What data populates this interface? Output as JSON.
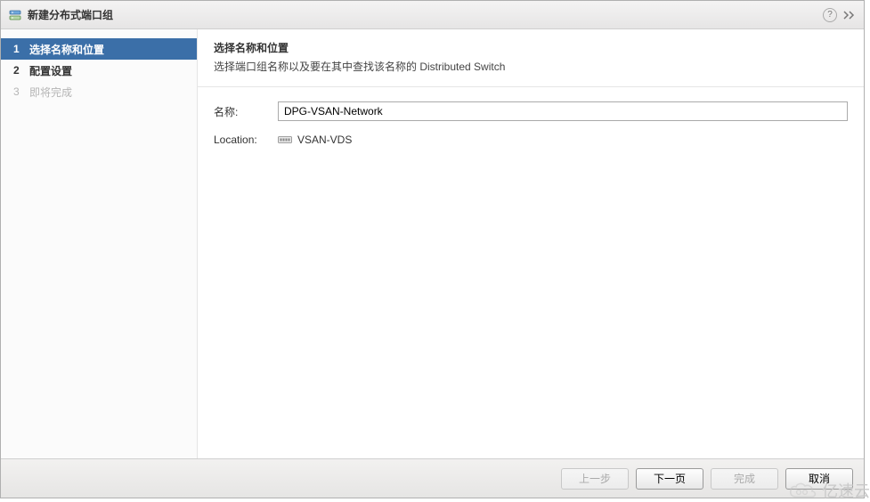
{
  "window": {
    "title": "新建分布式端口组"
  },
  "sidebar": {
    "steps": [
      {
        "num": "1",
        "label": "选择名称和位置"
      },
      {
        "num": "2",
        "label": "配置设置"
      },
      {
        "num": "3",
        "label": "即将完成"
      }
    ]
  },
  "content": {
    "heading": "选择名称和位置",
    "subtitle": "选择端口组名称以及要在其中查找该名称的 Distributed Switch",
    "name_label": "名称:",
    "name_value": "DPG-VSAN-Network",
    "location_label": "Location:",
    "location_value": "VSAN-VDS"
  },
  "footer": {
    "back": "上一步",
    "next": "下一页",
    "finish": "完成",
    "cancel": "取消"
  },
  "watermark": "亿速云"
}
